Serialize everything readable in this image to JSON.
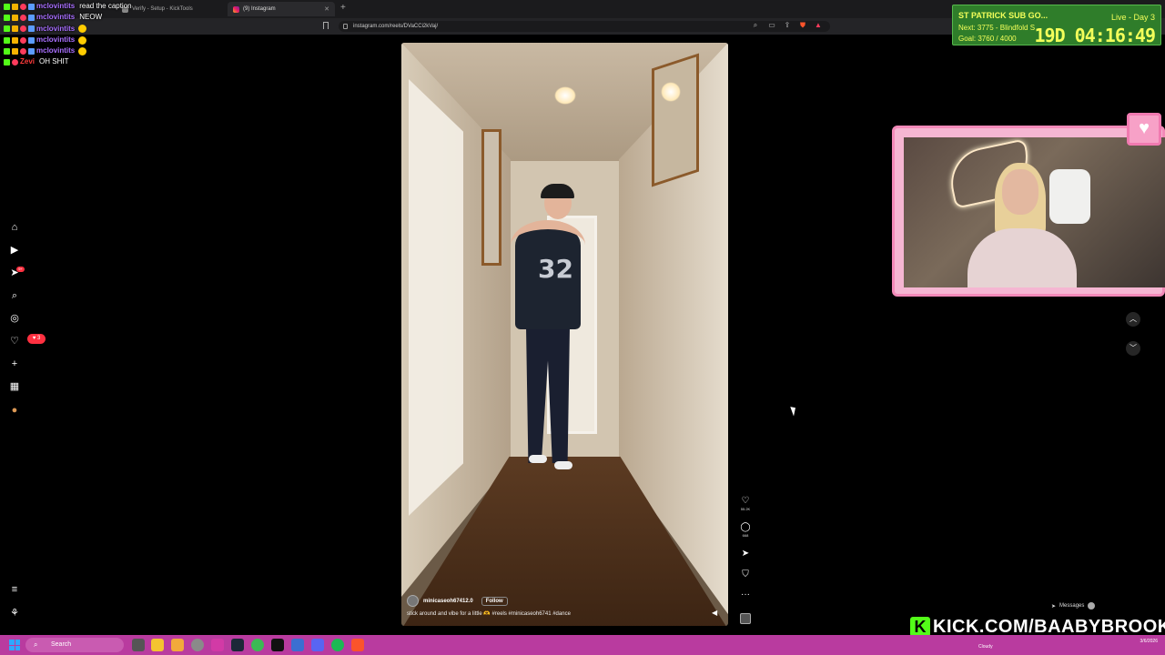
{
  "browser": {
    "tabs": [
      {
        "title": "Verify - Setup - KickTools"
      },
      {
        "title": "(9) Instagram"
      }
    ],
    "url": "instagram.com/reels/DVaCCi2kVaj/"
  },
  "chat": [
    {
      "user": "mclovintits",
      "message": "read the caption",
      "user_color": "#a970ff"
    },
    {
      "user": "mclovintits",
      "message": "NEOW",
      "user_color": "#a970ff"
    },
    {
      "user": "mclovintits",
      "message": "",
      "user_color": "#a970ff"
    },
    {
      "user": "mclovintits",
      "message": "",
      "user_color": "#a970ff"
    },
    {
      "user": "mclovintits",
      "message": "",
      "user_color": "#a970ff"
    },
    {
      "user": "Zevi",
      "message": "OH SHIT",
      "user_color": "#ff3b3b"
    }
  ],
  "sidebar": {
    "notif_count": "3",
    "messages_badge": "9+"
  },
  "reel": {
    "likes": "55.2K",
    "comments": "668",
    "author": "minicaseoh67412.0",
    "follow_label": "Follow",
    "caption": "stick around and vibe for a little 🫶 #reels #minicaseoh6741 #dance",
    "jersey_number": "32"
  },
  "goal": {
    "title": "ST PATRICK SUB GO...",
    "live": "Live - Day 3",
    "next": "Next: 3775 - Blindfold S",
    "progress": "Goal: 3760 / 4000",
    "timer": "19D 04:16:49"
  },
  "kick": {
    "url": "KICK.COM/BAABYBROOK"
  },
  "messages_label": "Messages",
  "taskbar": {
    "search_placeholder": "Search",
    "weather": "Cloudy",
    "date": "3/6/2026"
  },
  "colors": {
    "kick_green": "#53fc18",
    "taskbar": "#b93b9f",
    "cam_border": "#f38ab9"
  }
}
